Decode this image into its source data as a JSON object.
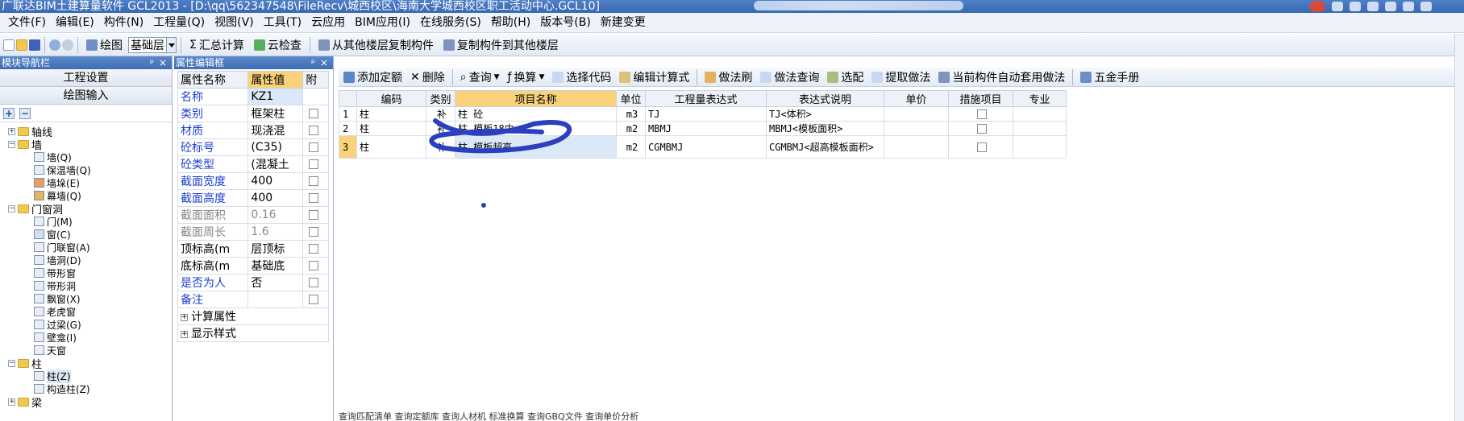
{
  "window": {
    "title": "广联达BIM土建算量软件 GCL2013 - [D:\\qq\\562347548\\FileRecv\\城西校区\\海南大学城西校区职工活动中心.GCL10]"
  },
  "menubar": {
    "items": [
      "文件(F)",
      "编辑(E)",
      "构件(N)",
      "工程量(Q)",
      "视图(V)",
      "工具(T)",
      "云应用",
      "BIM应用(I)",
      "在线服务(S)",
      "帮助(H)",
      "版本号(B)",
      "新建变更"
    ]
  },
  "toolbar": {
    "draw_label": "绘图",
    "floor_value": "基础层",
    "sum_label": "汇总计算",
    "cloud_check_label": "云检查",
    "copy_from_label": "从其他楼层复制构件",
    "copy_to_label": "复制构件到其他楼层"
  },
  "nav": {
    "title": "模块导航栏",
    "project_settings": "工程设置",
    "drawing_input": "绘图输入",
    "tree": [
      {
        "label": "轴线",
        "level": 0,
        "expanded": false
      },
      {
        "label": "墙",
        "level": 0,
        "expanded": true
      },
      {
        "label": "墙(Q)",
        "level": 1
      },
      {
        "label": "保温墙(Q)",
        "level": 1
      },
      {
        "label": "墙垛(E)",
        "level": 1
      },
      {
        "label": "幕墙(Q)",
        "level": 1
      },
      {
        "label": "门窗洞",
        "level": 0,
        "expanded": true
      },
      {
        "label": "门(M)",
        "level": 1
      },
      {
        "label": "窗(C)",
        "level": 1
      },
      {
        "label": "门联窗(A)",
        "level": 1
      },
      {
        "label": "墙洞(D)",
        "level": 1
      },
      {
        "label": "带形窗",
        "level": 1
      },
      {
        "label": "带形洞",
        "level": 1
      },
      {
        "label": "飘窗(X)",
        "level": 1
      },
      {
        "label": "老虎窗",
        "level": 1
      },
      {
        "label": "过梁(G)",
        "level": 1
      },
      {
        "label": "壁龛(I)",
        "level": 1
      },
      {
        "label": "天窗",
        "level": 1
      },
      {
        "label": "柱",
        "level": 0,
        "expanded": true
      },
      {
        "label": "柱(Z)",
        "level": 1
      },
      {
        "label": "构造柱(Z)",
        "level": 1
      },
      {
        "label": "梁",
        "level": 0,
        "expanded": false
      }
    ]
  },
  "props": {
    "title": "属性编辑框",
    "headers": [
      "属性名称",
      "属性值",
      "附"
    ],
    "rows": [
      {
        "name": "名称",
        "value": "KZ1",
        "style": "blue",
        "check": false
      },
      {
        "name": "类别",
        "value": "框架柱",
        "style": "blue",
        "check": true
      },
      {
        "name": "材质",
        "value": "现浇混",
        "style": "blue",
        "check": true
      },
      {
        "name": "砼标号",
        "value": "(C35)",
        "style": "blue",
        "check": true
      },
      {
        "name": "砼类型",
        "value": "(混凝土",
        "style": "blue",
        "check": true
      },
      {
        "name": "截面宽度",
        "value": "400",
        "style": "blue",
        "check": true
      },
      {
        "name": "截面高度",
        "value": "400",
        "style": "blue",
        "check": true
      },
      {
        "name": "截面面积",
        "value": "0.16",
        "style": "gray",
        "check": true
      },
      {
        "name": "截面周长",
        "value": "1.6",
        "style": "gray",
        "check": true
      },
      {
        "name": "顶标高(m",
        "value": "层顶标",
        "style": "black",
        "check": true
      },
      {
        "name": "底标高(m",
        "value": "基础底",
        "style": "black",
        "check": true
      },
      {
        "name": "是否为人",
        "value": "否",
        "style": "blue",
        "check": true
      },
      {
        "name": "备注",
        "value": "",
        "style": "blue",
        "check": true
      }
    ],
    "groups": [
      "计算属性",
      "显示样式"
    ]
  },
  "work_toolbar": {
    "add_quota": "添加定额",
    "delete": "删除",
    "query": "查询",
    "replace": "换算",
    "select_code": "选择代码",
    "edit_formula": "编辑计算式",
    "brush": "做法刷",
    "method_query": "做法查询",
    "pick": "选配",
    "extract": "提取做法",
    "auto_apply": "当前构件自动套用做法",
    "hardware": "五金手册"
  },
  "grid": {
    "headers": [
      "编码",
      "类别",
      "项目名称",
      "单位",
      "工程量表达式",
      "表达式说明",
      "单价",
      "措施项目",
      "专业"
    ],
    "rows": [
      {
        "num": "1",
        "code": "柱",
        "type": "补",
        "name": "柱 砼",
        "unit": "m3",
        "expr": "TJ",
        "desc": "TJ<体积>"
      },
      {
        "num": "2",
        "code": "柱",
        "type": "补",
        "name": "柱 模板18内",
        "unit": "m2",
        "expr": "MBMJ",
        "desc": "MBMJ<模板面积>"
      },
      {
        "num": "3",
        "code": "柱",
        "type": "补",
        "name": "柱 模板超高",
        "unit": "m2",
        "expr": "CGMBMJ",
        "desc": "CGMBMJ<超高模板面积>"
      }
    ]
  },
  "status": {
    "text": "查询匹配清单 查询定额库 查询人材机 标准换算 查询GBQ文件 查询单价分析"
  },
  "colors": {
    "title_bg": "#3a69b3",
    "header_selected": "#f9d27a",
    "annotation": "#2b3fbf"
  }
}
